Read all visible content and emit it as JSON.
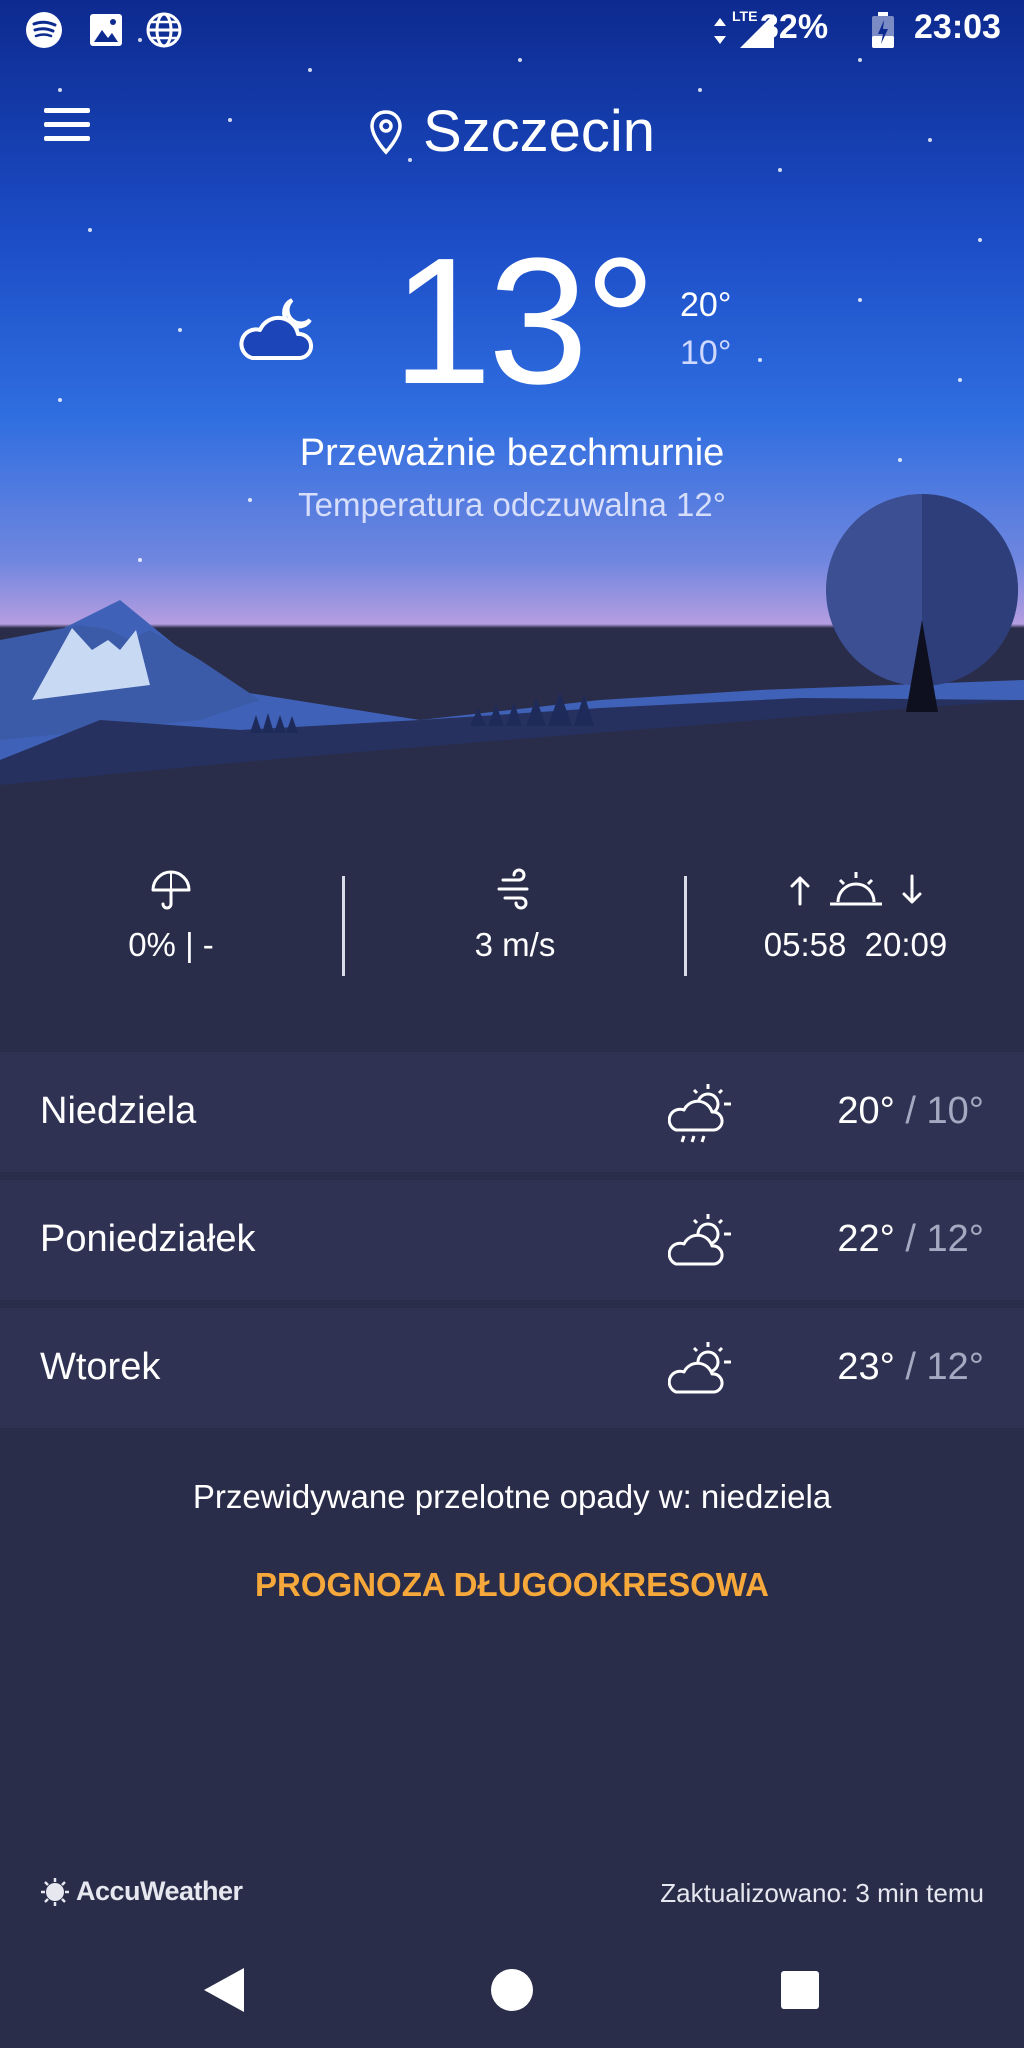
{
  "status_bar": {
    "network": "LTE",
    "battery": "32%",
    "time": "23:03",
    "icons": [
      "spotify-icon",
      "gallery-icon",
      "globe-icon",
      "signal-icon",
      "battery-icon"
    ]
  },
  "header": {
    "city": "Szczecin",
    "icons": [
      "menu-icon",
      "location-pin-icon"
    ]
  },
  "current": {
    "temperature": "13°",
    "high": "20°",
    "low": "10°",
    "condition": "Przeważnie bezchmurnie",
    "feels_like": "Temperatura odczuwalna 12°",
    "icon": "partly-cloudy-night-icon"
  },
  "stats": {
    "precipitation": "0% | -",
    "wind": "3 m/s",
    "sunrise": "05:58",
    "sunset": "20:09",
    "icons": [
      "umbrella-icon",
      "wind-icon",
      "sunrise-sunset-icon"
    ]
  },
  "forecast": [
    {
      "day": "Niedziela",
      "high": "20°",
      "low": "10°",
      "icon": "cloud-sun-rain-icon"
    },
    {
      "day": "Poniedziałek",
      "high": "22°",
      "low": "12°",
      "icon": "cloud-sun-icon"
    },
    {
      "day": "Wtorek",
      "high": "23°",
      "low": "12°",
      "icon": "cloud-sun-icon"
    }
  ],
  "separator": "/",
  "precip_note": "Przewidywane przelotne opady w: niedziela",
  "long_range_label": "PROGNOZA DŁUGOOKRESOWA",
  "brand": "AccuWeather",
  "updated": "Zaktualizowano: 3 min temu",
  "colors": {
    "accent": "#f7a83a",
    "background": "#2a2d4a",
    "row": "#2f3252",
    "sky_top": "#0d2a8f"
  }
}
